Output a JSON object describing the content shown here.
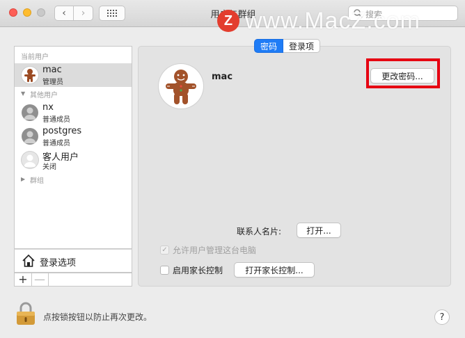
{
  "window": {
    "title": "用户与群组",
    "search_placeholder": "搜索"
  },
  "watermark": {
    "logo": "Z",
    "text": "www.MacZ.com"
  },
  "sidebar": {
    "current_users_label": "当前用户",
    "current_user": {
      "name": "mac",
      "role": "管理员"
    },
    "other_users_label": "其他用户",
    "other_users": [
      {
        "name": "nx",
        "role": "普通成员"
      },
      {
        "name": "postgres",
        "role": "普通成员"
      },
      {
        "name": "客人用户",
        "role": "关闭"
      }
    ],
    "groups_label": "群组",
    "login_options_label": "登录选项",
    "add_label": "+",
    "remove_label": "—"
  },
  "tabs": [
    {
      "label": "密码",
      "selected": true
    },
    {
      "label": "登录项",
      "selected": false
    }
  ],
  "detail": {
    "user_name": "mac",
    "change_password_label": "更改密码...",
    "contact_card_label": "联系人名片:",
    "open_label": "打开...",
    "allow_admin_label": "允许用户管理这台电脑",
    "allow_admin_checked": true,
    "allow_admin_enabled": false,
    "parental_controls_label": "启用家长控制",
    "parental_controls_checked": false,
    "open_parental_label": "打开家长控制..."
  },
  "footer": {
    "lock_text": "点按锁按钮以防止再次更改。",
    "help_label": "?"
  },
  "colors": {
    "accent": "#1f7cf6",
    "highlight": "#e60012",
    "watermark_logo": "#e33d2e"
  }
}
